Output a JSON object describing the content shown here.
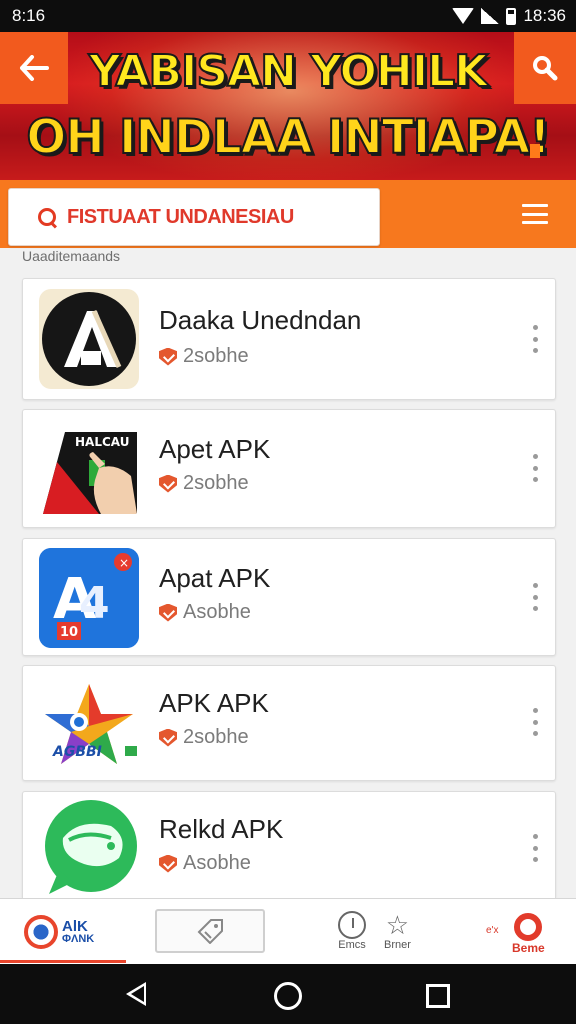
{
  "status_bar": {
    "time": "8:16",
    "clock_right": "18:36"
  },
  "banner": {
    "line1": "YABISAN YOHILK",
    "line2": "OH INDLAA INTIAPA!",
    "back_icon": "arrow-left-icon",
    "search_icon": "search-icon"
  },
  "search": {
    "text": "FISTUAAT UNDANESIAU"
  },
  "section_label": "Uaaditemaands",
  "apps": [
    {
      "name": "Daaka Unedndan",
      "status": "2sobhe",
      "icon": "black-circle-a-logo"
    },
    {
      "name": "Apet APK",
      "status": "2sobhe",
      "icon": "hand-on-screen-logo"
    },
    {
      "name": "Apat APK",
      "status": "Asobhe",
      "icon": "blue-a4-logo"
    },
    {
      "name": "APK APK",
      "status": "2sobhe",
      "icon": "colorful-star-logo"
    },
    {
      "name": "Relkd APK",
      "status": "Asobhe",
      "icon": "green-chat-logo"
    }
  ],
  "bottom_nav": {
    "logo_text": "AlK",
    "logo_subtext": "ΦΛΝΚ",
    "center_icon": "tag-icon",
    "item1": "Emcs",
    "item2": "Brner",
    "item3_small": "e'x",
    "item3": "Beme"
  },
  "colors": {
    "accent": "#f7781e",
    "red": "#d8382a",
    "banner_red": "#c71b1b"
  }
}
